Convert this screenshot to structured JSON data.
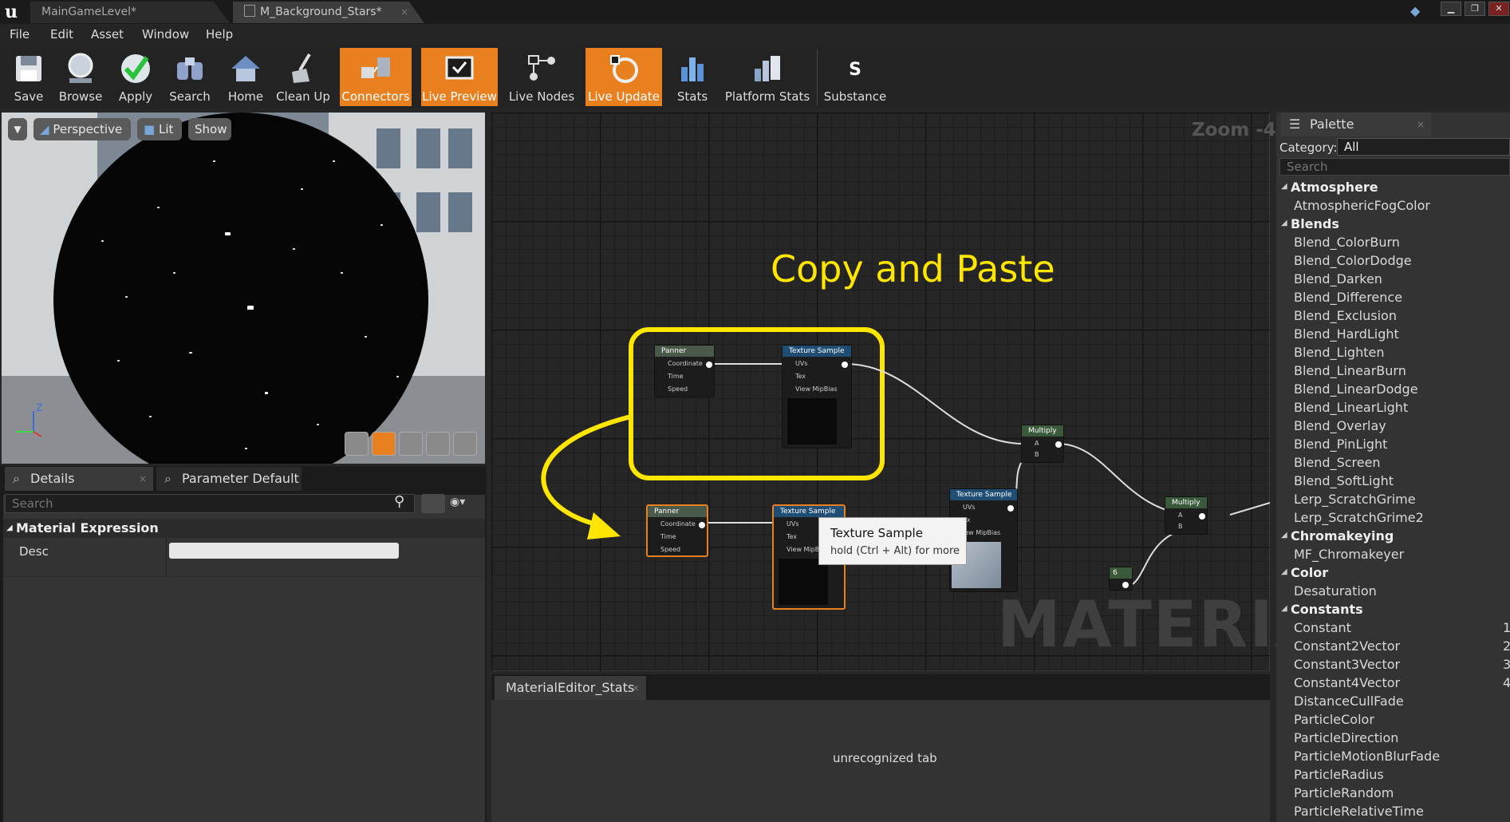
{
  "titlebar": {
    "tabs": [
      {
        "label": "MainGameLevel*"
      },
      {
        "label": "M_Background_Stars*"
      }
    ]
  },
  "menu": [
    "File",
    "Edit",
    "Asset",
    "Window",
    "Help"
  ],
  "toolbar": [
    {
      "label": "Save",
      "icon": "save-icon",
      "active": false
    },
    {
      "label": "Browse",
      "icon": "browse-icon",
      "active": false
    },
    {
      "label": "Apply",
      "icon": "apply-checkmark-icon",
      "active": false
    },
    {
      "label": "Search",
      "icon": "binoculars-icon",
      "active": false
    },
    {
      "label": "Home",
      "icon": "home-icon",
      "active": false
    },
    {
      "label": "Clean Up",
      "icon": "broom-icon",
      "active": false
    },
    {
      "label": "Connectors",
      "icon": "connectors-icon",
      "active": true
    },
    {
      "label": "Live Preview",
      "icon": "live-preview-icon",
      "active": true
    },
    {
      "label": "Live Nodes",
      "icon": "live-nodes-icon",
      "active": false
    },
    {
      "label": "Live Update",
      "icon": "live-update-icon",
      "active": true
    },
    {
      "label": "Stats",
      "icon": "stats-icon",
      "active": false
    },
    {
      "label": "Platform Stats",
      "icon": "platform-stats-icon",
      "active": false
    },
    {
      "label": "Substance",
      "icon": "substance-icon",
      "active": false
    }
  ],
  "viewport": {
    "perspective": "Perspective",
    "lit": "Lit",
    "show": "Show",
    "axis_z": "Z"
  },
  "details": {
    "tab1": "Details",
    "tab2": "Parameter Default",
    "search_placeholder": "Search",
    "category": "Material Expression",
    "prop_label": "Desc"
  },
  "graph": {
    "zoom": "Zoom -4",
    "annotation": "Copy and Paste",
    "watermark": "MATERIAL",
    "tooltip_title": "Texture Sample",
    "tooltip_hint": "hold (Ctrl + Alt) for more",
    "node_panner": "Panner",
    "node_texture": "Texture Sample",
    "node_multiply": "Multiply",
    "pin_coordinate": "Coordinate",
    "pin_time": "Time",
    "pin_speed": "Speed",
    "pin_uvs": "UVs",
    "pin_tex": "Tex",
    "pin_mipbias": "View MipBias",
    "pin_mipbias_cut": "View MipBi",
    "pin_mipbias_left": "iew MipBias",
    "pin_tex_cut": "ex",
    "pin_a": "A",
    "pin_b": "B",
    "const_value": "6"
  },
  "stats": {
    "tab": "MaterialEditor_Stats",
    "body": "unrecognized tab"
  },
  "palette": {
    "tab": "Palette",
    "category_label": "Category:",
    "category_value": "All",
    "search_placeholder": "Search",
    "groups": [
      {
        "name": "Atmosphere",
        "items": [
          "AtmosphericFogColor"
        ]
      },
      {
        "name": "Blends",
        "items": [
          "Blend_ColorBurn",
          "Blend_ColorDodge",
          "Blend_Darken",
          "Blend_Difference",
          "Blend_Exclusion",
          "Blend_HardLight",
          "Blend_Lighten",
          "Blend_LinearBurn",
          "Blend_LinearDodge",
          "Blend_LinearLight",
          "Blend_Overlay",
          "Blend_PinLight",
          "Blend_Screen",
          "Blend_SoftLight",
          "Lerp_ScratchGrime",
          "Lerp_ScratchGrime2"
        ]
      },
      {
        "name": "Chromakeying",
        "items": [
          "MF_Chromakeyer"
        ]
      },
      {
        "name": "Color",
        "items": [
          "Desaturation"
        ]
      },
      {
        "name": "Constants",
        "items": [
          "Constant",
          "Constant2Vector",
          "Constant3Vector",
          "Constant4Vector",
          "DistanceCullFade",
          "ParticleColor",
          "ParticleDirection",
          "ParticleMotionBlurFade",
          "ParticleRadius",
          "ParticleRandom",
          "ParticleRelativeTime"
        ]
      }
    ],
    "constant_hotkeys": [
      "1",
      "2",
      "3",
      "4"
    ]
  },
  "colors": {
    "accent_orange": "#e8801f",
    "highlight_yellow": "#ffe600",
    "node_head_green": "#3b5a3b",
    "node_head_blue": "#1f4d73"
  }
}
